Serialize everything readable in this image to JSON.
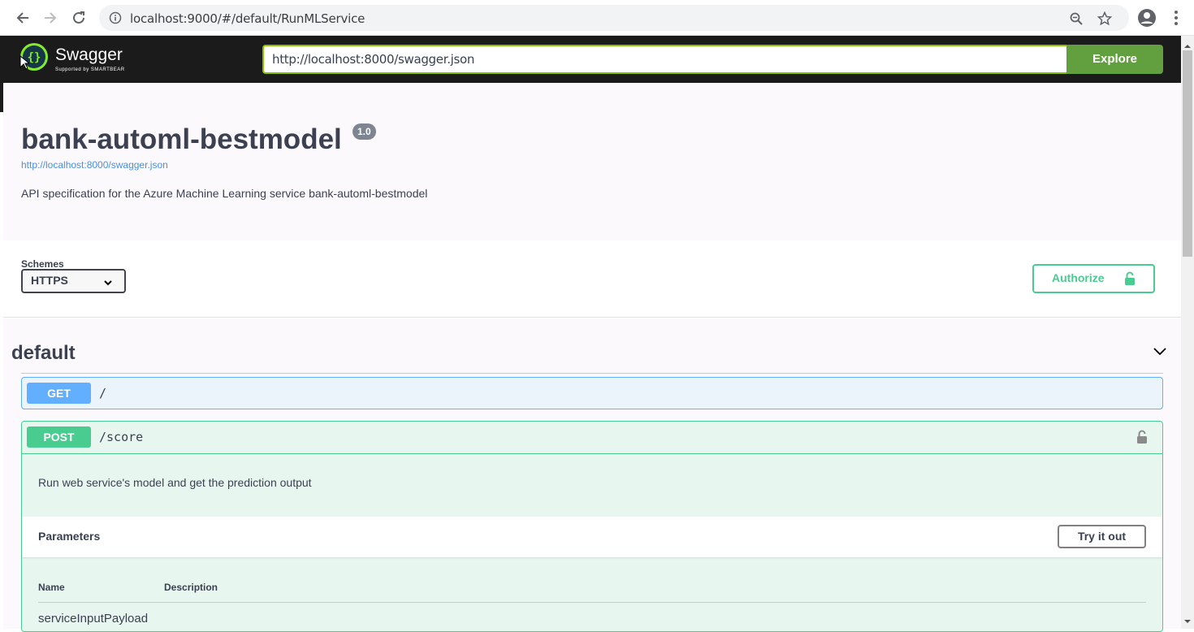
{
  "browser": {
    "url": "localhost:9000/#/default/RunMLService"
  },
  "topbar": {
    "logo_text": "Swagger",
    "logo_sub": "Supported by SMARTBEAR",
    "spec_url": "http://localhost:8000/swagger.json",
    "explore_label": "Explore"
  },
  "info": {
    "title": "bank-automl-bestmodel",
    "version": "1.0",
    "spec_link": "http://localhost:8000/swagger.json",
    "description": "API specification for the Azure Machine Learning service bank-automl-bestmodel"
  },
  "schemes": {
    "label": "Schemes",
    "selected": "HTTPS",
    "authorize_label": "Authorize"
  },
  "tag": {
    "name": "default"
  },
  "operations": [
    {
      "method": "GET",
      "path": "/"
    },
    {
      "method": "POST",
      "path": "/score",
      "description": "Run web service's model and get the prediction output",
      "parameters_label": "Parameters",
      "try_label": "Try it out",
      "col_name": "Name",
      "col_description": "Description",
      "param_name": "serviceInputPayload"
    }
  ],
  "colors": {
    "get": "#61affe",
    "post": "#49cc90",
    "explore": "#62a03f",
    "topbar": "#1b1b1b"
  }
}
